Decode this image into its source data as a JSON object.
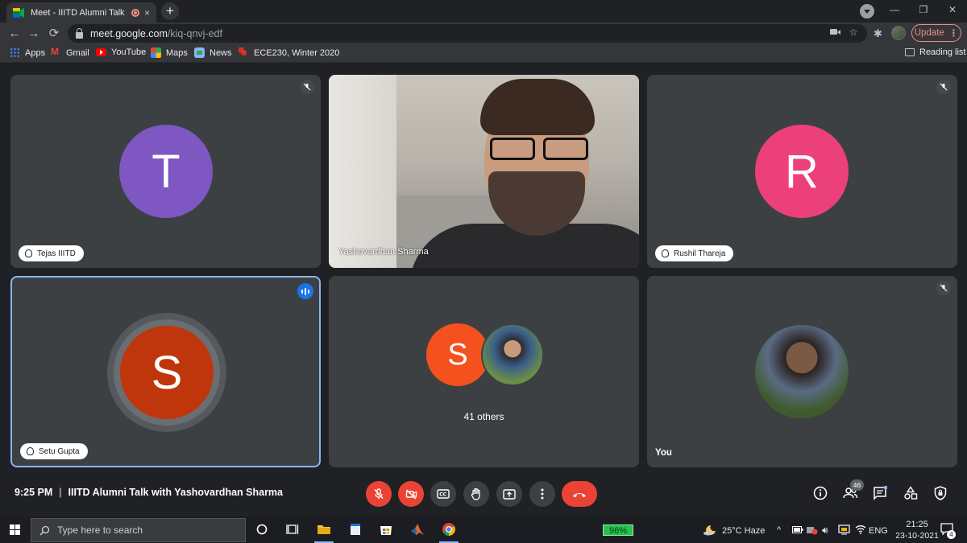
{
  "browser": {
    "tab_title": "Meet - IIITD Alumni Talk with",
    "tab_close": "×",
    "new_tab": "+",
    "url_host": "meet.google.com",
    "url_path": "/kiq-qnvj-edf",
    "update_label": "Update",
    "window_controls": [
      "—",
      "❐",
      "✕"
    ],
    "bookmarks": [
      {
        "label": "Apps",
        "icon": "apps-icon"
      },
      {
        "label": "Gmail",
        "icon": "gmail-icon"
      },
      {
        "label": "YouTube",
        "icon": "youtube-icon"
      },
      {
        "label": "Maps",
        "icon": "maps-icon"
      },
      {
        "label": "News",
        "icon": "news-icon"
      },
      {
        "label": "ECE230, Winter 2020",
        "icon": "ece-icon"
      }
    ],
    "reading_list": "Reading list"
  },
  "meet": {
    "tiles": [
      {
        "name": "Tejas IIITD",
        "initial": "T",
        "color": "#7e57c2",
        "muted": true
      },
      {
        "name": "Yashovardhan Sharma",
        "video": true
      },
      {
        "name": "Rushil Thareja",
        "initial": "R",
        "color": "#ec407a",
        "muted": true
      },
      {
        "name": "Setu Gupta",
        "initial": "S",
        "color": "#c0360c",
        "speaking": true
      },
      {
        "others_label": "41 others",
        "initial": "S",
        "color": "#f4511e"
      },
      {
        "name": "You",
        "muted": true
      }
    ],
    "time": "9:25 PM",
    "separator": "|",
    "meeting_title": "IIITD Alumni Talk with Yashovardhan Sharma",
    "participants_count": "46",
    "accent": "#8ab4f8",
    "danger": "#ea4335"
  },
  "taskbar": {
    "search_placeholder": "Type here to search",
    "battery": "96%",
    "weather": "25°C  Haze",
    "language": "ENG",
    "clock_time": "21:25",
    "clock_date": "23-10-2021",
    "notifications": "4"
  }
}
